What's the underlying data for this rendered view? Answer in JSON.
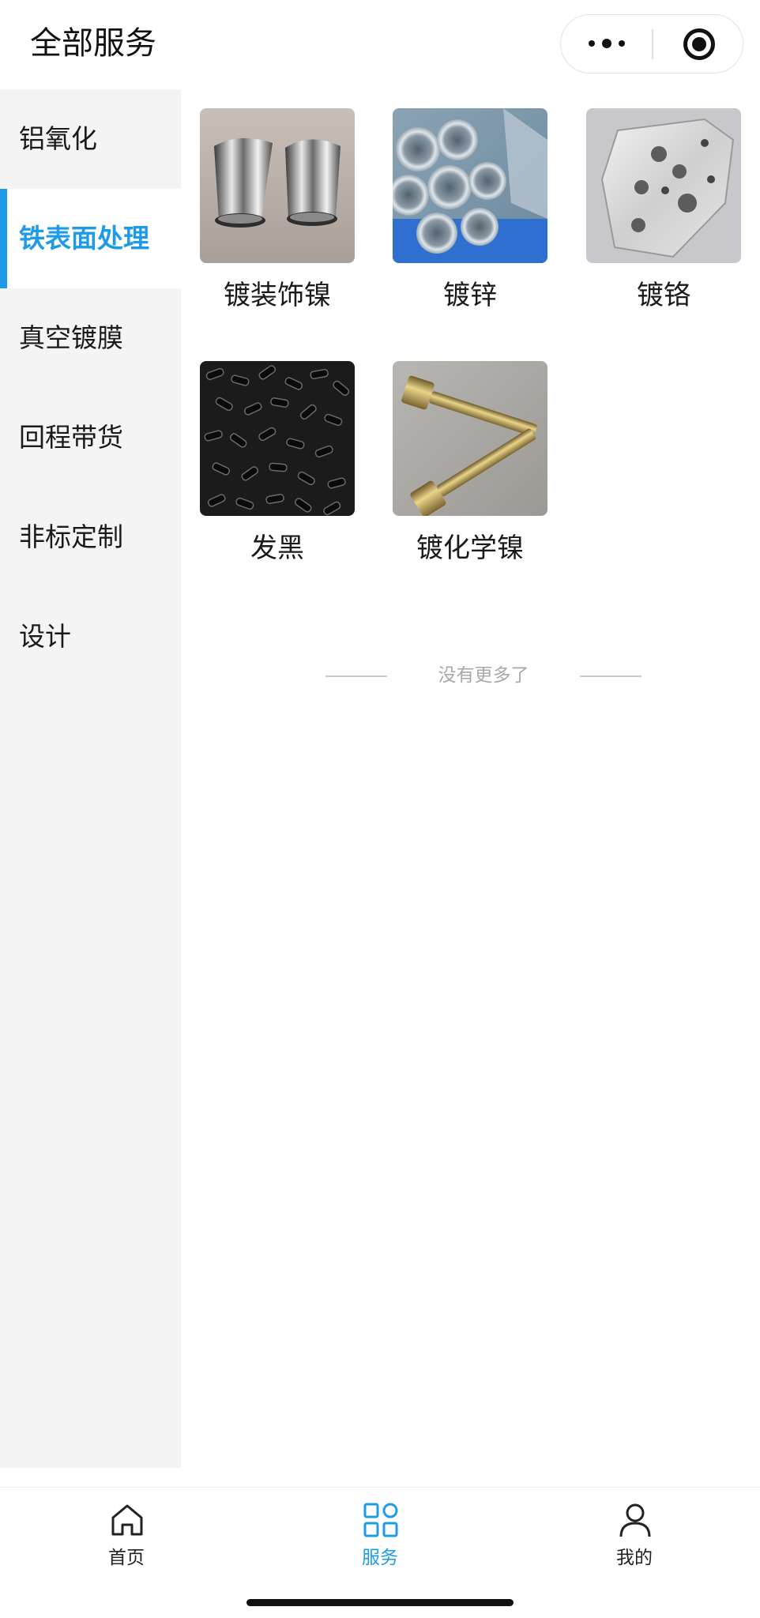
{
  "header": {
    "title": "全部服务"
  },
  "sidebar": {
    "items": [
      {
        "label": "铝氧化",
        "active": false
      },
      {
        "label": "铁表面处理",
        "active": true
      },
      {
        "label": "真空镀膜",
        "active": false
      },
      {
        "label": "回程带货",
        "active": false
      },
      {
        "label": "非标定制",
        "active": false
      },
      {
        "label": "设计",
        "active": false
      }
    ],
    "accent_color": "#1e9be8"
  },
  "services": [
    {
      "name": "镀装饰镍",
      "image": "polished-nickel-cups-photo"
    },
    {
      "name": "镀锌",
      "image": "galvanized-pipes-photo"
    },
    {
      "name": "镀铬",
      "image": "chrome-plate-part-photo"
    },
    {
      "name": "发黑",
      "image": "black-oxide-pellets-photo"
    },
    {
      "name": "镀化学镍",
      "image": "knurled-screws-photo"
    }
  ],
  "list_end_text": "没有更多了",
  "tabbar": {
    "tabs": [
      {
        "label": "首页",
        "icon": "home-icon",
        "active": false
      },
      {
        "label": "服务",
        "icon": "grid-icon",
        "active": true
      },
      {
        "label": "我的",
        "icon": "user-icon",
        "active": false
      }
    ]
  }
}
